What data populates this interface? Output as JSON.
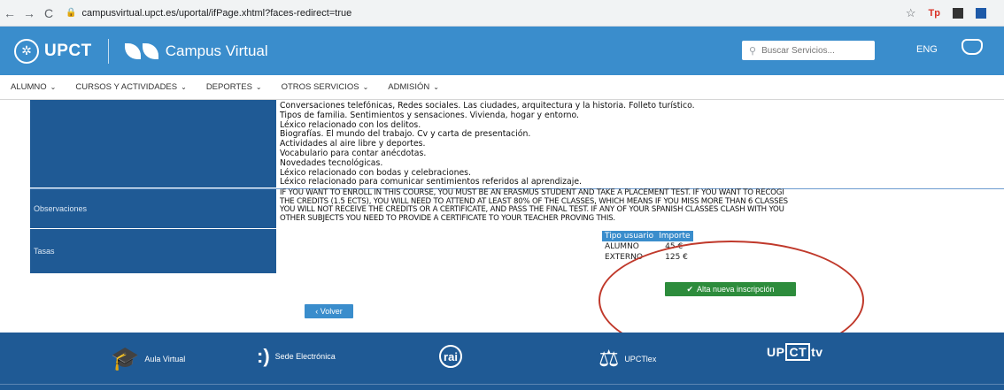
{
  "browser": {
    "back": "←",
    "forward": "→",
    "reload": "C",
    "url": "campusvirtual.upct.es/uportal/ifPage.xhtml?faces-redirect=true",
    "star": "☆",
    "extension_red": "Tp"
  },
  "header": {
    "logo_text": "UPCT",
    "app_title": "Campus Virtual",
    "search_placeholder": "Buscar Servicios...",
    "language": "ENG"
  },
  "menu": [
    {
      "label": "ALUMNO"
    },
    {
      "label": "CURSOS Y ACTIVIDADES"
    },
    {
      "label": "DEPORTES"
    },
    {
      "label": "OTROS SERVICIOS"
    },
    {
      "label": "ADMISIÓN"
    }
  ],
  "details": {
    "contents_lines": [
      "Conversaciones telefónicas, Redes sociales. Las ciudades,  arquitectura y la historia. Folleto turístico.",
      "Tipos de familia. Sentimientos y sensaciones. Vivienda, hogar y entorno.",
      "Léxico relacionado con los delitos.",
      "Biografías. El mundo del trabajo. Cv y carta de presentación.",
      "Actividades al aire libre y deportes.",
      "Vocabulario para contar anécdotas.",
      "Novedades tecnológicas.",
      "Léxico relacionado con bodas y celebraciones.",
      "Léxico relacionado para comunicar sentimientos referidos al aprendizaje."
    ],
    "observaciones_label": "Observaciones",
    "observaciones_lines": [
      "IF YOU WANT TO ENROLL IN THIS COURSE, YOU MUST BE AN ERASMUS STUDENT AND TAKE A PLACEMENT TEST. IF YOU WANT TO RECOGI",
      "THE CREDITS (1.5 ECTS), YOU WILL NEED TO ATTEND AT LEAST 80% OF THE CLASSES, WHICH MEANS IF YOU MISS MORE THAN 6 CLASSES",
      "YOU WILL NOT RECEIVE THE CREDITS OR A CERTIFICATE, AND PASS THE FINAL TEST. IF ANY OF YOUR SPANISH CLASSES CLASH WITH YOU",
      "OTHER SUBJECTS YOU NEED TO PROVIDE A CERTIFICATE TO YOUR TEACHER PROVING THIS."
    ],
    "tasas_label": "Tasas",
    "fees": {
      "headers": [
        "Tipo usuario",
        "Importe"
      ],
      "rows": [
        [
          "ALUMNO",
          "45 €"
        ],
        [
          "EXTERNO",
          "125 €"
        ]
      ]
    }
  },
  "actions": {
    "back_label": "Volver",
    "enroll_label": "Alta nueva inscripción"
  },
  "footer": {
    "aula_virtual": "Aula Virtual",
    "sede": "Sede Electrónica",
    "crai": "rai",
    "upctlex": "UPCTlex",
    "upcttv_prefix": "UP",
    "upcttv_box": "CT",
    "upcttv_suffix": "tv"
  },
  "colors": {
    "header_blue": "#3a8dcc",
    "label_navy": "#1f5a95",
    "enroll_green": "#2d8c3c",
    "annotation_red": "#c0392b"
  }
}
